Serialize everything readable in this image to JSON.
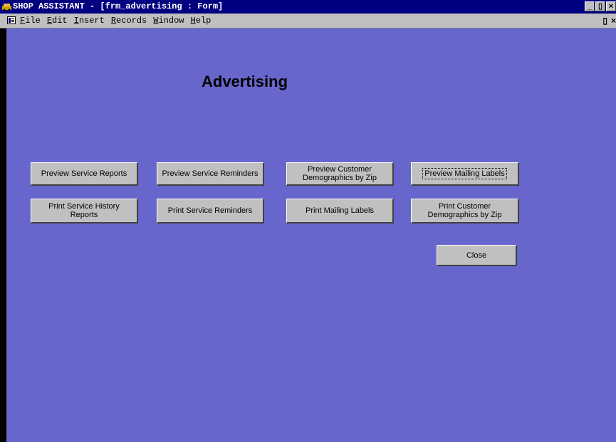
{
  "window": {
    "title": "SHOP ASSISTANT - [frm_advertising : Form]",
    "controls": {
      "minimize": "_",
      "restore": "▯",
      "close": "×"
    },
    "doc_controls": {
      "restore": "▯",
      "close": "×"
    }
  },
  "menu": {
    "items": [
      {
        "label": "File",
        "hotkey": "F"
      },
      {
        "label": "Edit",
        "hotkey": "E"
      },
      {
        "label": "Insert",
        "hotkey": "I"
      },
      {
        "label": "Records",
        "hotkey": "R"
      },
      {
        "label": "Window",
        "hotkey": "W"
      },
      {
        "label": "Help",
        "hotkey": "H"
      }
    ]
  },
  "form": {
    "heading": "Advertising",
    "buttons": {
      "preview_service_reports": "Preview Service Reports",
      "preview_service_reminders": "Preview Service Reminders",
      "preview_customer_demographics": "Preview Customer\nDemographics by Zip",
      "preview_mailing_labels": "Preview Mailing Labels",
      "print_service_history": "Print Service History\nReports",
      "print_service_reminders": "Print Service Reminders",
      "print_mailing_labels": "Print Mailing Labels",
      "print_customer_demographics": "Print Customer\nDemographics by Zip",
      "close": "Close"
    }
  },
  "colors": {
    "title_bar": "#000080",
    "form_background": "#6666cc",
    "button_face": "#c0c0c0"
  }
}
